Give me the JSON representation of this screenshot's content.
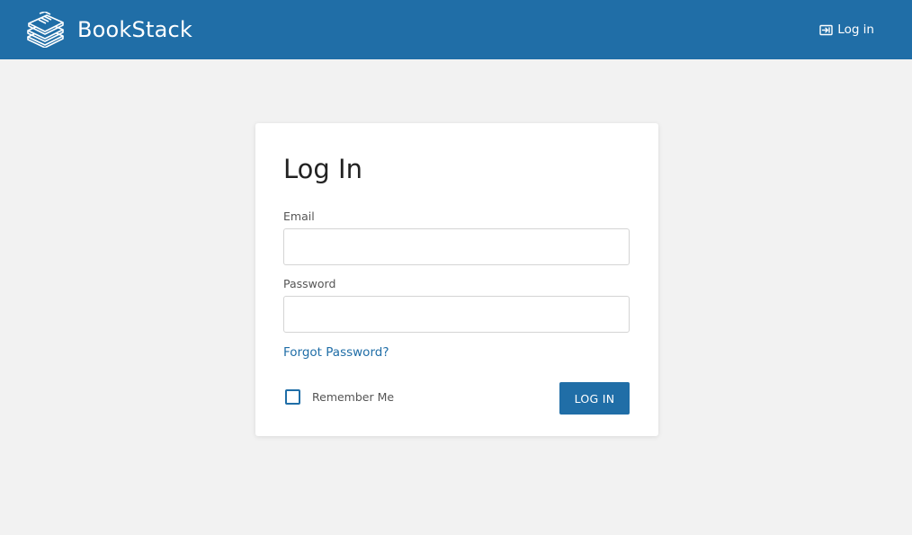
{
  "header": {
    "brand_name": "BookStack",
    "brand_icon": "bookstack-logo-icon",
    "login_label": "Log in",
    "login_icon": "login-icon",
    "background_color": "#206ea7"
  },
  "login_form": {
    "title": "Log In",
    "email": {
      "label": "Email",
      "value": "",
      "placeholder": ""
    },
    "password": {
      "label": "Password",
      "value": "",
      "placeholder": ""
    },
    "forgot_password_label": "Forgot Password?",
    "remember_me": {
      "label": "Remember Me",
      "checked": false
    },
    "submit_label": "LOG IN"
  },
  "colors": {
    "accent": "#206ea7",
    "page_background": "#f2f2f2",
    "card_background": "#ffffff"
  }
}
